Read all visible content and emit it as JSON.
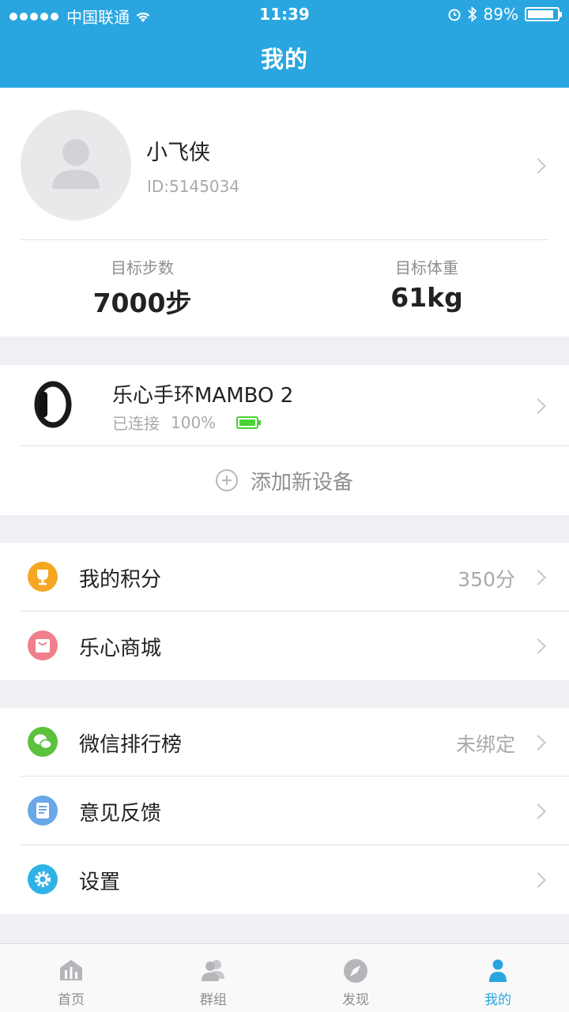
{
  "status_bar": {
    "carrier": "中国联通",
    "time": "11:39",
    "battery_text": "89%",
    "battery_level": 0.89
  },
  "header": {
    "title": "我的"
  },
  "profile": {
    "name": "小飞侠",
    "id": "ID:5145034",
    "stats": [
      {
        "label": "目标步数",
        "value": "7000步"
      },
      {
        "label": "目标体重",
        "value": "61kg"
      }
    ]
  },
  "device": {
    "name": "乐心手环MAMBO 2",
    "status": "已连接",
    "battery": "100%",
    "add_label": "添加新设备"
  },
  "menu_group1": [
    {
      "label": "我的积分",
      "value": "350分",
      "icon": "trophy-icon",
      "color": "#f5a623"
    },
    {
      "label": "乐心商城",
      "value": "",
      "icon": "shopping-bag-icon",
      "color": "#f07f8c"
    }
  ],
  "menu_group2": [
    {
      "label": "微信排行榜",
      "value": "未绑定",
      "icon": "wechat-icon",
      "color": "#5cc13b"
    },
    {
      "label": "意见反馈",
      "value": "",
      "icon": "feedback-icon",
      "color": "#6aa7e8"
    },
    {
      "label": "设置",
      "value": "",
      "icon": "gear-icon",
      "color": "#2fb3e6"
    }
  ],
  "tabs": [
    {
      "label": "首页",
      "icon": "home-chart-icon"
    },
    {
      "label": "群组",
      "icon": "group-icon"
    },
    {
      "label": "发现",
      "icon": "compass-icon"
    },
    {
      "label": "我的",
      "icon": "person-icon",
      "active": true
    }
  ],
  "colors": {
    "accent": "#29a6e0",
    "battery_green": "#4cd137"
  }
}
